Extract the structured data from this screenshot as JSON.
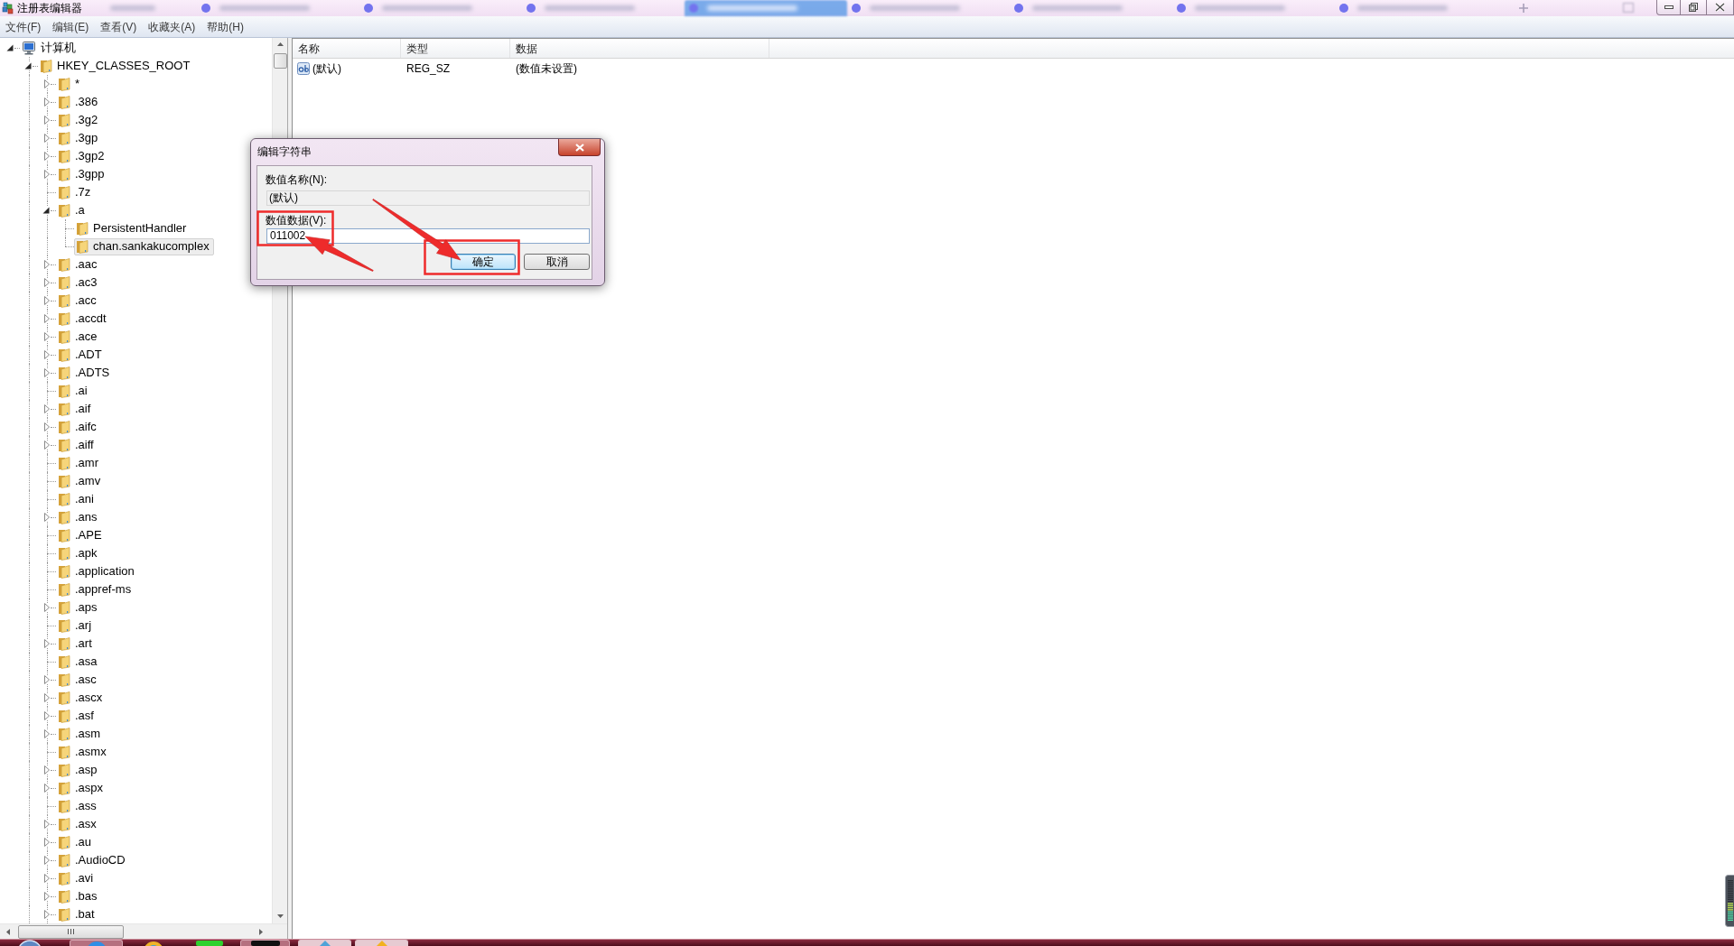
{
  "window": {
    "title": "注册表编辑器"
  },
  "background_tabs": [
    {
      "selected": false
    },
    {
      "selected": false
    },
    {
      "selected": false
    },
    {
      "selected": true
    },
    {
      "selected": false
    },
    {
      "selected": false
    },
    {
      "selected": false
    },
    {
      "selected": false
    }
  ],
  "menu": [
    {
      "label": "文件(F)"
    },
    {
      "label": "编辑(E)"
    },
    {
      "label": "查看(V)"
    },
    {
      "label": "收藏夹(A)"
    },
    {
      "label": "帮助(H)"
    }
  ],
  "tree": {
    "continues_below": true,
    "items": [
      {
        "kind": "computer",
        "label": "计算机",
        "expandable": true,
        "expanded": true,
        "selected": false,
        "children": [
          {
            "kind": "folder",
            "label": "HKEY_CLASSES_ROOT",
            "expandable": true,
            "expanded": true,
            "selected": false,
            "children": [
              {
                "kind": "folder",
                "label": "*",
                "expandable": true,
                "expanded": false,
                "selected": false
              },
              {
                "kind": "folder",
                "label": ".386",
                "expandable": true,
                "expanded": false,
                "selected": false
              },
              {
                "kind": "folder",
                "label": ".3g2",
                "expandable": true,
                "expanded": false,
                "selected": false
              },
              {
                "kind": "folder",
                "label": ".3gp",
                "expandable": true,
                "expanded": false,
                "selected": false
              },
              {
                "kind": "folder",
                "label": ".3gp2",
                "expandable": true,
                "expanded": false,
                "selected": false
              },
              {
                "kind": "folder",
                "label": ".3gpp",
                "expandable": true,
                "expanded": false,
                "selected": false
              },
              {
                "kind": "folder",
                "label": ".7z",
                "expandable": false,
                "expanded": false,
                "selected": false
              },
              {
                "kind": "folder",
                "label": ".a",
                "expandable": true,
                "expanded": true,
                "selected": false,
                "children": [
                  {
                    "kind": "folder",
                    "label": "PersistentHandler",
                    "expandable": false,
                    "expanded": false,
                    "selected": false
                  },
                  {
                    "kind": "folder",
                    "label": "chan.sankakucomplex",
                    "expandable": false,
                    "expanded": false,
                    "selected": true
                  }
                ]
              },
              {
                "kind": "folder",
                "label": ".aac",
                "expandable": true,
                "expanded": false,
                "selected": false
              },
              {
                "kind": "folder",
                "label": ".ac3",
                "expandable": true,
                "expanded": false,
                "selected": false
              },
              {
                "kind": "folder",
                "label": ".acc",
                "expandable": true,
                "expanded": false,
                "selected": false
              },
              {
                "kind": "folder",
                "label": ".accdt",
                "expandable": true,
                "expanded": false,
                "selected": false
              },
              {
                "kind": "folder",
                "label": ".ace",
                "expandable": true,
                "expanded": false,
                "selected": false
              },
              {
                "kind": "folder",
                "label": ".ADT",
                "expandable": true,
                "expanded": false,
                "selected": false
              },
              {
                "kind": "folder",
                "label": ".ADTS",
                "expandable": true,
                "expanded": false,
                "selected": false
              },
              {
                "kind": "folder",
                "label": ".ai",
                "expandable": false,
                "expanded": false,
                "selected": false
              },
              {
                "kind": "folder",
                "label": ".aif",
                "expandable": true,
                "expanded": false,
                "selected": false
              },
              {
                "kind": "folder",
                "label": ".aifc",
                "expandable": true,
                "expanded": false,
                "selected": false
              },
              {
                "kind": "folder",
                "label": ".aiff",
                "expandable": true,
                "expanded": false,
                "selected": false
              },
              {
                "kind": "folder",
                "label": ".amr",
                "expandable": false,
                "expanded": false,
                "selected": false
              },
              {
                "kind": "folder",
                "label": ".amv",
                "expandable": false,
                "expanded": false,
                "selected": false
              },
              {
                "kind": "folder",
                "label": ".ani",
                "expandable": false,
                "expanded": false,
                "selected": false
              },
              {
                "kind": "folder",
                "label": ".ans",
                "expandable": true,
                "expanded": false,
                "selected": false
              },
              {
                "kind": "folder",
                "label": ".APE",
                "expandable": false,
                "expanded": false,
                "selected": false
              },
              {
                "kind": "folder",
                "label": ".apk",
                "expandable": false,
                "expanded": false,
                "selected": false
              },
              {
                "kind": "folder",
                "label": ".application",
                "expandable": false,
                "expanded": false,
                "selected": false
              },
              {
                "kind": "folder",
                "label": ".appref-ms",
                "expandable": false,
                "expanded": false,
                "selected": false
              },
              {
                "kind": "folder",
                "label": ".aps",
                "expandable": true,
                "expanded": false,
                "selected": false
              },
              {
                "kind": "folder",
                "label": ".arj",
                "expandable": false,
                "expanded": false,
                "selected": false
              },
              {
                "kind": "folder",
                "label": ".art",
                "expandable": true,
                "expanded": false,
                "selected": false
              },
              {
                "kind": "folder",
                "label": ".asa",
                "expandable": false,
                "expanded": false,
                "selected": false
              },
              {
                "kind": "folder",
                "label": ".asc",
                "expandable": true,
                "expanded": false,
                "selected": false
              },
              {
                "kind": "folder",
                "label": ".ascx",
                "expandable": true,
                "expanded": false,
                "selected": false
              },
              {
                "kind": "folder",
                "label": ".asf",
                "expandable": true,
                "expanded": false,
                "selected": false
              },
              {
                "kind": "folder",
                "label": ".asm",
                "expandable": true,
                "expanded": false,
                "selected": false
              },
              {
                "kind": "folder",
                "label": ".asmx",
                "expandable": false,
                "expanded": false,
                "selected": false
              },
              {
                "kind": "folder",
                "label": ".asp",
                "expandable": true,
                "expanded": false,
                "selected": false
              },
              {
                "kind": "folder",
                "label": ".aspx",
                "expandable": true,
                "expanded": false,
                "selected": false
              },
              {
                "kind": "folder",
                "label": ".ass",
                "expandable": false,
                "expanded": false,
                "selected": false
              },
              {
                "kind": "folder",
                "label": ".asx",
                "expandable": true,
                "expanded": false,
                "selected": false
              },
              {
                "kind": "folder",
                "label": ".au",
                "expandable": true,
                "expanded": false,
                "selected": false
              },
              {
                "kind": "folder",
                "label": ".AudioCD",
                "expandable": true,
                "expanded": false,
                "selected": false
              },
              {
                "kind": "folder",
                "label": ".avi",
                "expandable": true,
                "expanded": false,
                "selected": false
              },
              {
                "kind": "folder",
                "label": ".bas",
                "expandable": true,
                "expanded": false,
                "selected": false
              },
              {
                "kind": "folder",
                "label": ".bat",
                "expandable": true,
                "expanded": false,
                "selected": false
              }
            ]
          }
        ]
      }
    ]
  },
  "values_list": {
    "columns": [
      "名称",
      "类型",
      "数据"
    ],
    "rows": [
      {
        "name": "(默认)",
        "type": "REG_SZ",
        "data": "(数值未设置)"
      }
    ]
  },
  "dialog": {
    "title": "编辑字符串",
    "name_label": "数值名称(N):",
    "name_value": "(默认)",
    "data_label": "数值数据(V):",
    "data_value": "011002",
    "buttons": [
      {
        "label": "确定",
        "default": true
      },
      {
        "label": "取消",
        "default": false
      }
    ]
  }
}
